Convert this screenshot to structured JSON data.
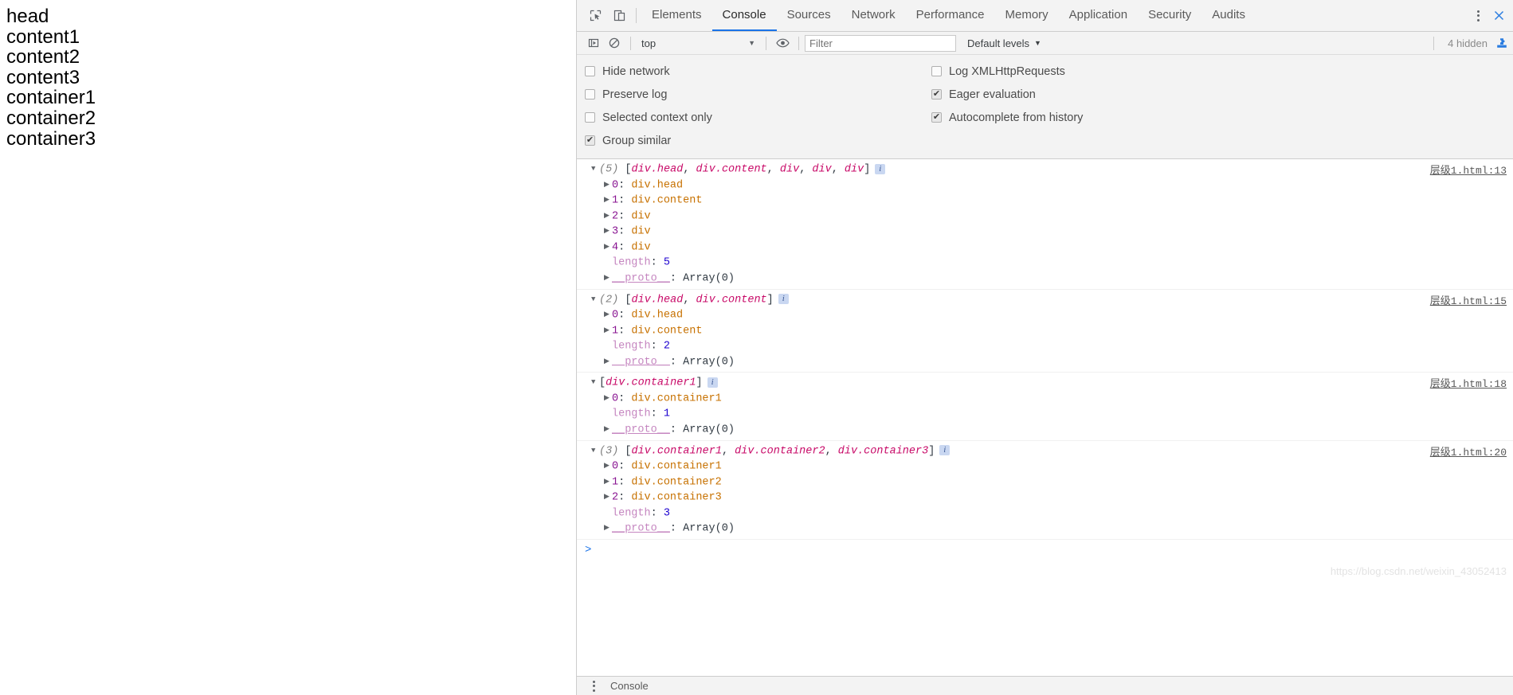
{
  "page": {
    "lines": [
      "head",
      "content1",
      "content2",
      "content3",
      "container1",
      "container2",
      "container3"
    ]
  },
  "devtools": {
    "icons": {
      "inspect": "inspect-element-icon",
      "device": "device-toolbar-icon",
      "kebab": "more-options-icon",
      "close": "close-devtools-icon"
    },
    "tabs": [
      {
        "label": "Elements",
        "active": false
      },
      {
        "label": "Console",
        "active": true
      },
      {
        "label": "Sources",
        "active": false
      },
      {
        "label": "Network",
        "active": false
      },
      {
        "label": "Performance",
        "active": false
      },
      {
        "label": "Memory",
        "active": false
      },
      {
        "label": "Application",
        "active": false
      },
      {
        "label": "Security",
        "active": false
      },
      {
        "label": "Audits",
        "active": false
      }
    ],
    "accent_color": "#1a73e8",
    "filterbar": {
      "clear_icon": "clear-console-icon",
      "no_entry_icon": "no-entry-icon",
      "context_value": "top",
      "context_caret": "▼",
      "eye_icon": "live-expression-eye-icon",
      "filter_value": "",
      "filter_placeholder": "Filter",
      "levels_label": "Default levels",
      "levels_caret": "▼",
      "hidden_count": "4 hidden",
      "puzzle_icon": "console-settings-puzzle-icon"
    },
    "settings": {
      "left": [
        {
          "label": "Hide network",
          "checked": false
        },
        {
          "label": "Preserve log",
          "checked": false
        },
        {
          "label": "Selected context only",
          "checked": false
        },
        {
          "label": "Group similar",
          "checked": true
        }
      ],
      "right": [
        {
          "label": "Log XMLHttpRequests",
          "checked": false
        },
        {
          "label": "Eager evaluation",
          "checked": true
        },
        {
          "label": "Autocomplete from history",
          "checked": true
        }
      ]
    },
    "messages": [
      {
        "count": "(5)",
        "preview_items": [
          {
            "text": "div.head",
            "kind": "tag"
          },
          {
            "text": "div.content",
            "kind": "tag"
          },
          {
            "text": "div",
            "kind": "tag"
          },
          {
            "text": "div",
            "kind": "tag"
          },
          {
            "text": "div",
            "kind": "tag"
          }
        ],
        "info_badge": "i",
        "source": "层级1.html:13",
        "rows": [
          {
            "idx": "0",
            "value": "div.head"
          },
          {
            "idx": "1",
            "value": "div.content"
          },
          {
            "idx": "2",
            "value": "div"
          },
          {
            "idx": "3",
            "value": "div"
          },
          {
            "idx": "4",
            "value": "div"
          }
        ],
        "length_key": "length",
        "length_value": "5",
        "proto_key": "__proto__",
        "proto_value": "Array(0)"
      },
      {
        "count": "(2)",
        "preview_items": [
          {
            "text": "div.head",
            "kind": "tag"
          },
          {
            "text": "div.content",
            "kind": "tag"
          }
        ],
        "info_badge": "i",
        "source": "层级1.html:15",
        "rows": [
          {
            "idx": "0",
            "value": "div.head"
          },
          {
            "idx": "1",
            "value": "div.content"
          }
        ],
        "length_key": "length",
        "length_value": "2",
        "proto_key": "__proto__",
        "proto_value": "Array(0)"
      },
      {
        "count": "",
        "preview_items": [
          {
            "text": "div.container1",
            "kind": "tag"
          }
        ],
        "info_badge": "i",
        "source": "层级1.html:18",
        "rows": [
          {
            "idx": "0",
            "value": "div.container1"
          }
        ],
        "length_key": "length",
        "length_value": "1",
        "proto_key": "__proto__",
        "proto_value": "Array(0)"
      },
      {
        "count": "(3)",
        "preview_items": [
          {
            "text": "div.container1",
            "kind": "tag"
          },
          {
            "text": "div.container2",
            "kind": "tag"
          },
          {
            "text": "div.container3",
            "kind": "tag"
          }
        ],
        "info_badge": "i",
        "source": "层级1.html:20",
        "rows": [
          {
            "idx": "0",
            "value": "div.container1"
          },
          {
            "idx": "1",
            "value": "div.container2"
          },
          {
            "idx": "2",
            "value": "div.container3"
          }
        ],
        "length_key": "length",
        "length_value": "3",
        "proto_key": "__proto__",
        "proto_value": "Array(0)"
      }
    ],
    "prompt": {
      "caret": ">",
      "value": ""
    },
    "drawer": {
      "tab_label": "Console",
      "kebab_icon": "drawer-more-options-icon"
    }
  },
  "watermark": {
    "text": "https://blog.csdn.net/weixin_43052413"
  }
}
